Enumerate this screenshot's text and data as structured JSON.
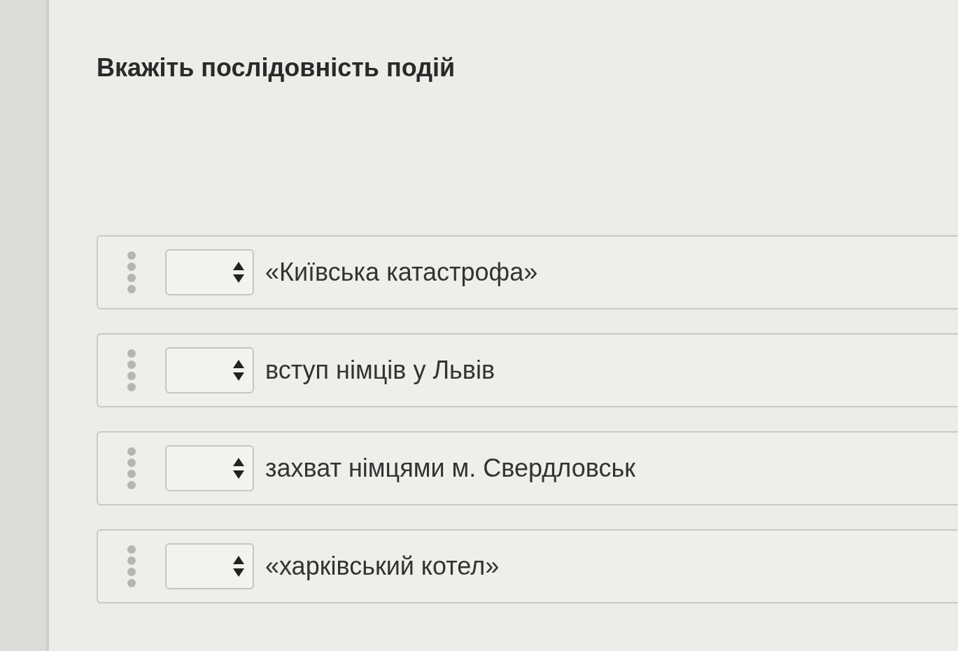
{
  "question": {
    "title": "Вкажіть послідовність подій"
  },
  "items": [
    {
      "text": "«Київська катастрофа»"
    },
    {
      "text": "вступ німців у Львів"
    },
    {
      "text": "захват німцями м. Свердловськ"
    },
    {
      "text": "«харківський котел»"
    }
  ]
}
